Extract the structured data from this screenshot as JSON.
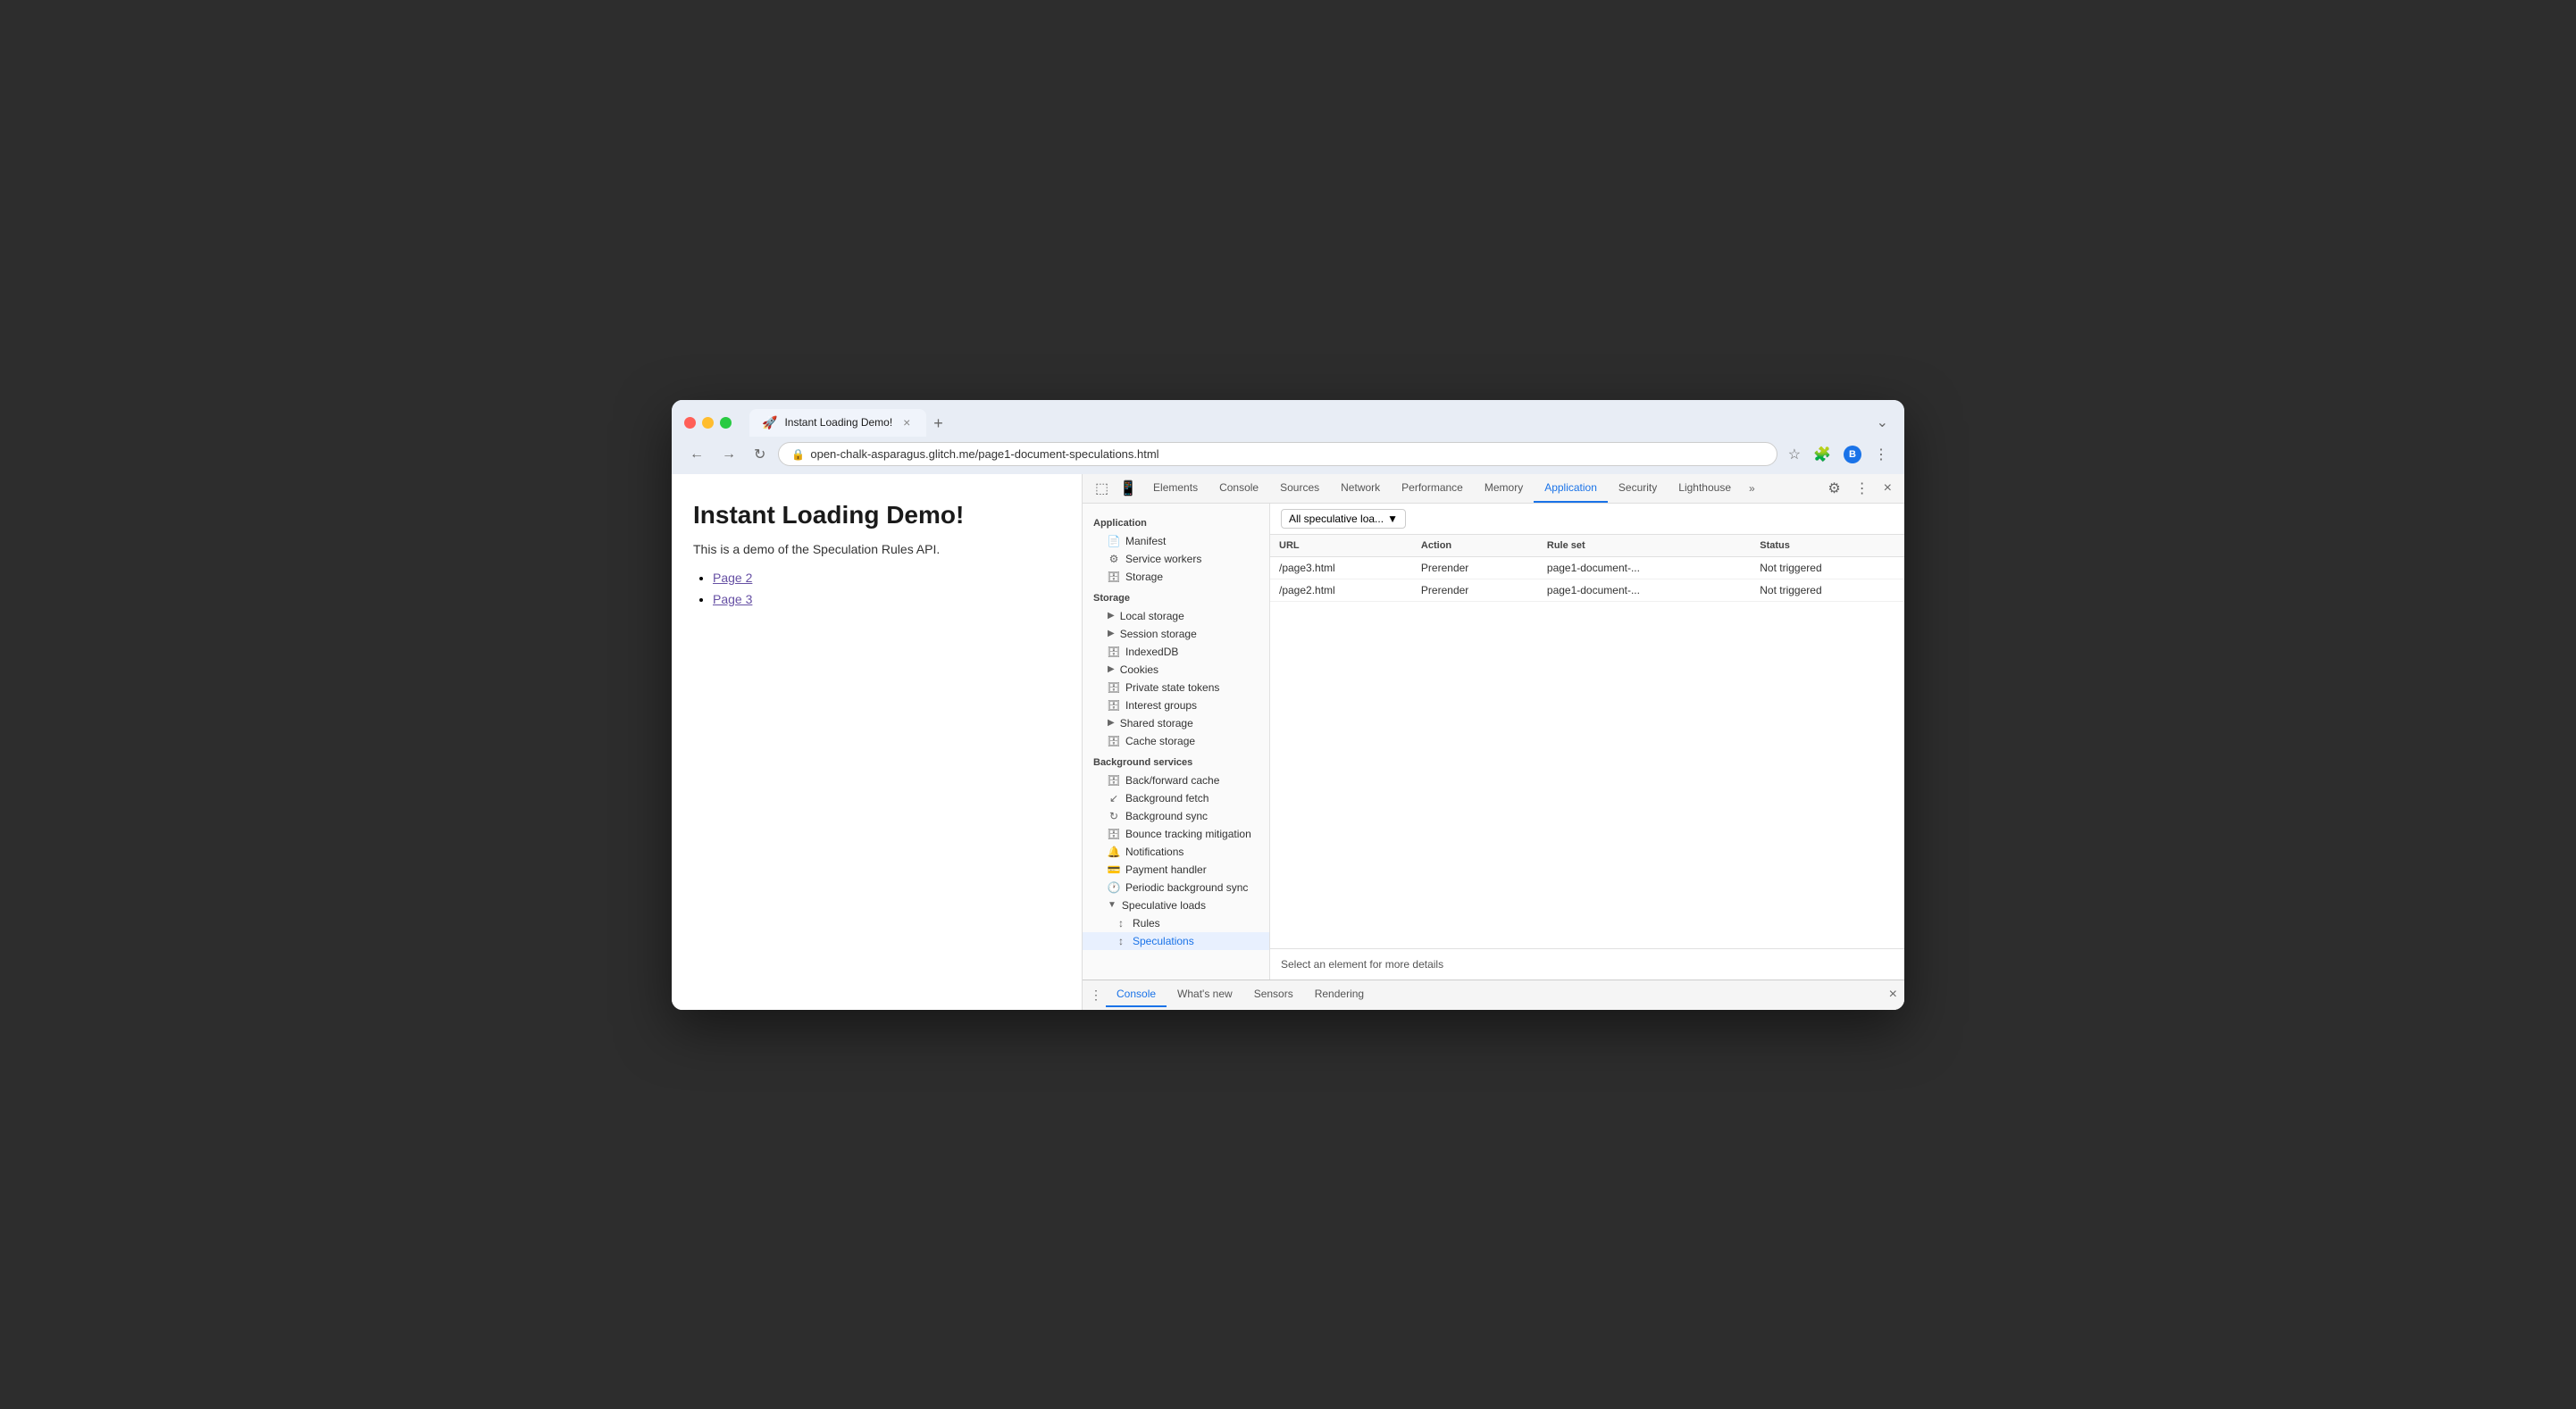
{
  "browser": {
    "tab_title": "Instant Loading Demo!",
    "tab_favicon": "🚀",
    "close_label": "×",
    "new_tab_label": "+",
    "back_label": "←",
    "forward_label": "→",
    "reload_label": "↻",
    "url": "open-chalk-asparagus.glitch.me/page1-document-speculations.html",
    "url_icon": "🔒",
    "star_label": "☆",
    "ext_label": "🧩",
    "profile_label": "B",
    "more_label": "⋮",
    "overflow_label": "⌄"
  },
  "page": {
    "title": "Instant Loading Demo!",
    "description": "This is a demo of the Speculation Rules API.",
    "links": [
      "Page 2",
      "Page 3"
    ]
  },
  "devtools": {
    "tabs": [
      {
        "label": "Elements",
        "active": false
      },
      {
        "label": "Console",
        "active": false
      },
      {
        "label": "Sources",
        "active": false
      },
      {
        "label": "Network",
        "active": false
      },
      {
        "label": "Performance",
        "active": false
      },
      {
        "label": "Memory",
        "active": false
      },
      {
        "label": "Application",
        "active": true
      },
      {
        "label": "Security",
        "active": false
      },
      {
        "label": "Lighthouse",
        "active": false
      }
    ],
    "more_tabs_label": "»",
    "settings_label": "⚙",
    "more_label": "⋮",
    "close_label": "×",
    "inspect_icon": "⬚",
    "device_icon": "📱",
    "sidebar": {
      "application_section": "Application",
      "application_items": [
        {
          "label": "Manifest",
          "icon": "📄",
          "indent": 1
        },
        {
          "label": "Service workers",
          "icon": "⚙",
          "indent": 1
        },
        {
          "label": "Storage",
          "icon": "🗄",
          "indent": 1
        }
      ],
      "storage_section": "Storage",
      "storage_items": [
        {
          "label": "Local storage",
          "icon": "▶",
          "indent": 1,
          "expandable": true
        },
        {
          "label": "Session storage",
          "icon": "▶",
          "indent": 1,
          "expandable": true
        },
        {
          "label": "IndexedDB",
          "icon": "🗄",
          "indent": 1
        },
        {
          "label": "Cookies",
          "icon": "▶",
          "indent": 1,
          "expandable": true
        },
        {
          "label": "Private state tokens",
          "icon": "🗄",
          "indent": 1
        },
        {
          "label": "Interest groups",
          "icon": "🗄",
          "indent": 1
        },
        {
          "label": "Shared storage",
          "icon": "▶",
          "indent": 1,
          "expandable": true
        },
        {
          "label": "Cache storage",
          "icon": "🗄",
          "indent": 1
        }
      ],
      "background_section": "Background services",
      "background_items": [
        {
          "label": "Back/forward cache",
          "icon": "🗄",
          "indent": 1
        },
        {
          "label": "Background fetch",
          "icon": "↙",
          "indent": 1
        },
        {
          "label": "Background sync",
          "icon": "↻",
          "indent": 1
        },
        {
          "label": "Bounce tracking mitigation",
          "icon": "🗄",
          "indent": 1
        },
        {
          "label": "Notifications",
          "icon": "🔔",
          "indent": 1
        },
        {
          "label": "Payment handler",
          "icon": "💳",
          "indent": 1
        },
        {
          "label": "Periodic background sync",
          "icon": "🕐",
          "indent": 1
        },
        {
          "label": "Speculative loads",
          "icon": "▼",
          "indent": 1,
          "expandable": true,
          "expanded": true
        },
        {
          "label": "Rules",
          "icon": "↕",
          "indent": 2
        },
        {
          "label": "Speculations",
          "icon": "↕",
          "indent": 2,
          "active": true
        }
      ]
    },
    "panel": {
      "filter_label": "All speculative loa...",
      "filter_arrow": "▼",
      "table": {
        "columns": [
          "URL",
          "Action",
          "Rule set",
          "Status"
        ],
        "rows": [
          {
            "url": "/page3.html",
            "action": "Prerender",
            "rule_set": "page1-document-...",
            "status": "Not triggered"
          },
          {
            "url": "/page2.html",
            "action": "Prerender",
            "rule_set": "page1-document-...",
            "status": "Not triggered"
          }
        ]
      },
      "bottom_message": "Select an element for more details"
    }
  },
  "drawer": {
    "menu_label": "⋮",
    "tabs": [
      {
        "label": "Console",
        "active": true
      },
      {
        "label": "What's new",
        "active": false
      },
      {
        "label": "Sensors",
        "active": false
      },
      {
        "label": "Rendering",
        "active": false
      }
    ],
    "close_label": "×"
  }
}
